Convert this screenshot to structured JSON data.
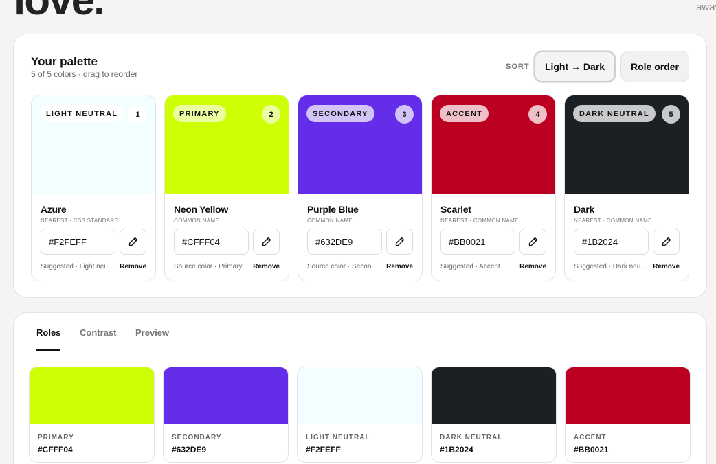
{
  "header": {
    "hero_text": "love.",
    "right_text": "away"
  },
  "palette": {
    "title": "Your palette",
    "subtitle": "5 of 5 colors · drag to reorder",
    "sort_label": "SORT",
    "sort_options": {
      "light_dark": "Light → Dark",
      "role_order": "Role order"
    },
    "active_sort": "light_dark",
    "cards": [
      {
        "role": "LIGHT NEUTRAL",
        "number": "1",
        "color": "#F2FEFF",
        "name": "Azure",
        "meta": "NEAREST · CSS STANDARD",
        "hex": "#F2FEFF",
        "footnote": "Suggested · Light neutral",
        "remove": "Remove",
        "pill_bg": "#ffffff",
        "pill_fg": "#111111",
        "badge_bg": "#ffffff",
        "badge_fg": "#111111"
      },
      {
        "role": "PRIMARY",
        "number": "2",
        "color": "#CFFF04",
        "name": "Neon Yellow",
        "meta": "COMMON NAME",
        "hex": "#CFFF04",
        "footnote": "Source color · Primary",
        "remove": "Remove",
        "pill_bg": "#ecffa0",
        "pill_fg": "#111111",
        "badge_bg": "#ecffa0",
        "badge_fg": "#111111"
      },
      {
        "role": "SECONDARY",
        "number": "3",
        "color": "#632DE9",
        "name": "Purple Blue",
        "meta": "COMMON NAME",
        "hex": "#632DE9",
        "footnote": "Source color · Secondary",
        "remove": "Remove",
        "pill_bg": "#d2c4f8",
        "pill_fg": "#111111",
        "badge_bg": "#d2c4f8",
        "badge_fg": "#111111"
      },
      {
        "role": "ACCENT",
        "number": "4",
        "color": "#BB0021",
        "name": "Scarlet",
        "meta": "NEAREST · COMMON NAME",
        "hex": "#BB0021",
        "footnote": "Suggested · Accent",
        "remove": "Remove",
        "pill_bg": "#f0c0c8",
        "pill_fg": "#111111",
        "badge_bg": "#f0c0c8",
        "badge_fg": "#111111"
      },
      {
        "role": "DARK NEUTRAL",
        "number": "5",
        "color": "#1B2024",
        "name": "Dark",
        "meta": "NEAREST · COMMON NAME",
        "hex": "#1B2024",
        "footnote": "Suggested · Dark neutral",
        "remove": "Remove",
        "pill_bg": "#c8c9cb",
        "pill_fg": "#111111",
        "badge_bg": "#c8c9cb",
        "badge_fg": "#111111"
      }
    ]
  },
  "tabs": {
    "items": [
      "Roles",
      "Contrast",
      "Preview"
    ],
    "active": "Roles"
  },
  "roles": [
    {
      "label": "PRIMARY",
      "hex": "#CFFF04",
      "color": "#CFFF04"
    },
    {
      "label": "SECONDARY",
      "hex": "#632DE9",
      "color": "#632DE9"
    },
    {
      "label": "LIGHT NEUTRAL",
      "hex": "#F2FEFF",
      "color": "#F2FEFF"
    },
    {
      "label": "DARK NEUTRAL",
      "hex": "#1B2024",
      "color": "#1B2024"
    },
    {
      "label": "ACCENT",
      "hex": "#BB0021",
      "color": "#BB0021"
    }
  ]
}
